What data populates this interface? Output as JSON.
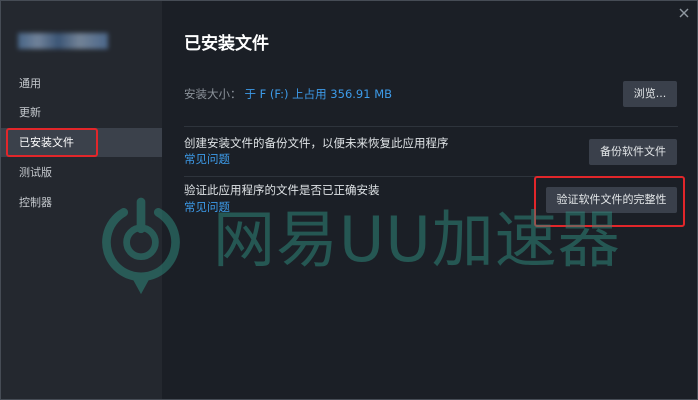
{
  "sidebar": {
    "items": [
      {
        "label": "通用",
        "selected": false
      },
      {
        "label": "更新",
        "selected": false
      },
      {
        "label": "已安装文件",
        "selected": true
      },
      {
        "label": "测试版",
        "selected": false
      },
      {
        "label": "控制器",
        "selected": false
      }
    ]
  },
  "main": {
    "title": "已安装文件",
    "install_size": {
      "label": "安装大小：",
      "value": "于 F (F:) 上占用 356.91 MB",
      "button": "浏览..."
    },
    "backup": {
      "text": "创建安装文件的备份文件，以便未来恢复此应用程序",
      "link": "常见问题",
      "button": "备份软件文件"
    },
    "verify": {
      "text": "验证此应用程序的文件是否已正确安装",
      "link": "常见问题",
      "button": "验证软件文件的完整性"
    }
  },
  "watermark": {
    "text": "网易UU加速器"
  },
  "icons": {
    "close": "close-icon",
    "watermark_logo": "uu-logo-icon"
  },
  "colors": {
    "main_bg": "#1b1f26",
    "sidebar_bg": "#24282f",
    "sidebar_selected_bg": "#3b414b",
    "link": "#3d9be9",
    "button_bg": "#3a404b",
    "divider": "#2e343c",
    "annotation": "#e2262a",
    "watermark": "#2f8f80"
  }
}
